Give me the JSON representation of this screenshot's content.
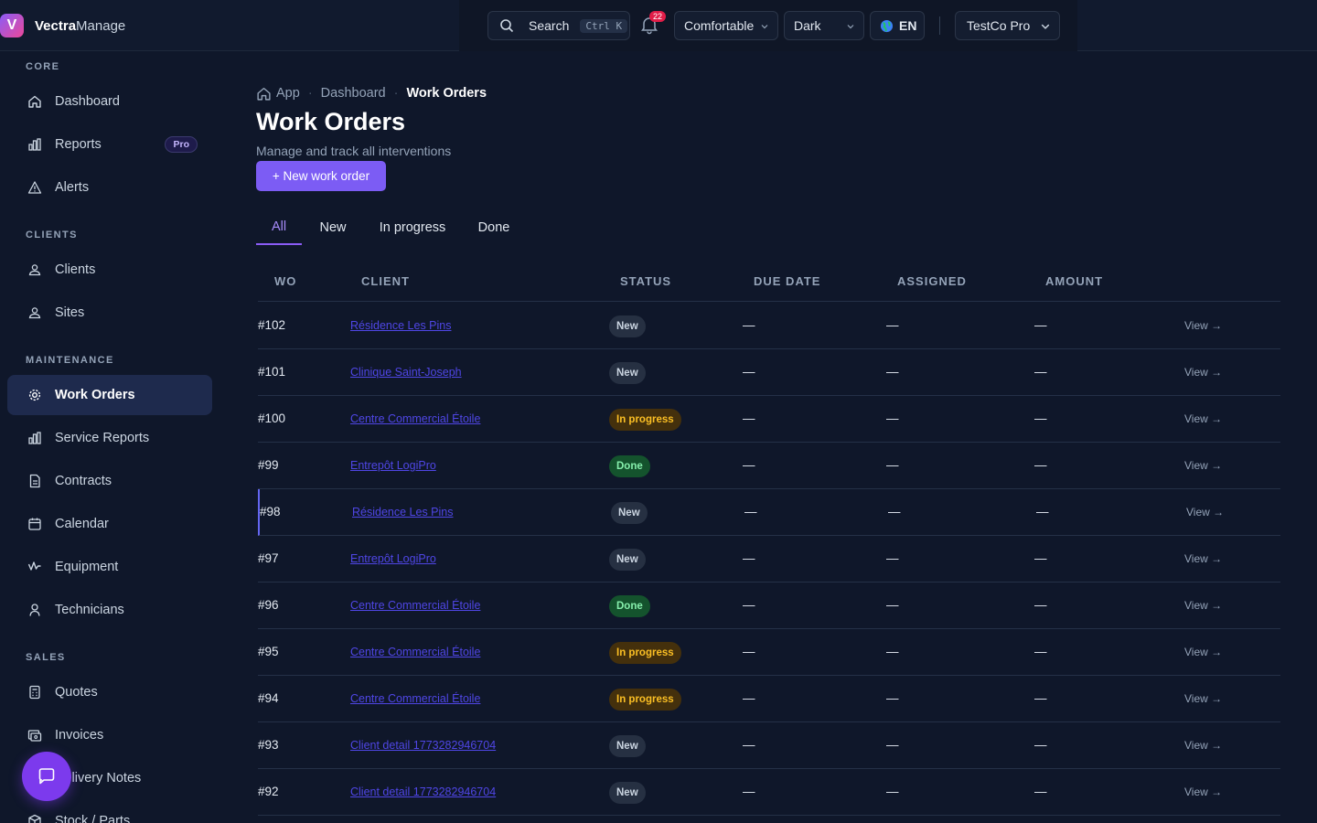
{
  "brand": {
    "name_bold": "Vectra",
    "name_light": "Manage",
    "logo_letter": "V"
  },
  "topbar": {
    "search_label": "Search",
    "search_shortcut": "Ctrl K",
    "notifications_count": "22",
    "density_label": "Comfortable",
    "theme_label": "Dark",
    "language_label": "EN",
    "org_label": "TestCo Pro"
  },
  "sidebar": {
    "sections": [
      {
        "title": "CORE",
        "items": [
          {
            "label": "Dashboard",
            "icon": "home-icon"
          },
          {
            "label": "Reports",
            "icon": "bar-chart-icon",
            "badge": "Pro"
          },
          {
            "label": "Alerts",
            "icon": "warning-icon"
          }
        ]
      },
      {
        "title": "CLIENTS",
        "items": [
          {
            "label": "Clients",
            "icon": "user-icon"
          },
          {
            "label": "Sites",
            "icon": "user-icon"
          }
        ]
      },
      {
        "title": "MAINTENANCE",
        "items": [
          {
            "label": "Work Orders",
            "icon": "gear-icon",
            "active": true
          },
          {
            "label": "Service Reports",
            "icon": "bar-chart-icon"
          },
          {
            "label": "Contracts",
            "icon": "document-icon"
          },
          {
            "label": "Calendar",
            "icon": "calendar-icon"
          },
          {
            "label": "Equipment",
            "icon": "activity-icon"
          },
          {
            "label": "Technicians",
            "icon": "person-icon"
          }
        ]
      },
      {
        "title": "SALES",
        "items": [
          {
            "label": "Quotes",
            "icon": "calculator-icon"
          },
          {
            "label": "Invoices",
            "icon": "invoice-icon"
          },
          {
            "label": "Delivery Notes",
            "icon": "truck-icon"
          },
          {
            "label": "Stock / Parts",
            "icon": "box-icon"
          }
        ]
      }
    ],
    "chat_icon": "chat-icon"
  },
  "main": {
    "breadcrumb": [
      "App",
      "Dashboard",
      "Work Orders"
    ],
    "title": "Work Orders",
    "subtitle": "Manage and track all interventions",
    "new_button": "+ New work order",
    "tabs": [
      "All",
      "New",
      "In progress",
      "Done"
    ],
    "active_tab": "All",
    "columns": [
      "WO",
      "CLIENT",
      "STATUS",
      "DUE DATE",
      "ASSIGNED",
      "AMOUNT"
    ],
    "rows": [
      {
        "wo": "#102",
        "client": "Résidence Les Pins",
        "status": "New",
        "due": "—",
        "assigned": "—",
        "amount": "—",
        "action": "View →"
      },
      {
        "wo": "#101",
        "client": "Clinique Saint-Joseph",
        "status": "New",
        "due": "—",
        "assigned": "—",
        "amount": "—",
        "action": "View →"
      },
      {
        "wo": "#100",
        "client": "Centre Commercial Étoile",
        "status": "In progress",
        "due": "—",
        "assigned": "—",
        "amount": "—",
        "action": "View →"
      },
      {
        "wo": "#99",
        "client": "Entrepôt LogiPro",
        "status": "Done",
        "due": "—",
        "assigned": "—",
        "amount": "—",
        "action": "View →"
      },
      {
        "wo": "#98",
        "client": "Résidence Les Pins",
        "status": "New",
        "due": "—",
        "assigned": "—",
        "amount": "—",
        "action": "View →"
      },
      {
        "wo": "#97",
        "client": "Entrepôt LogiPro",
        "status": "New",
        "due": "—",
        "assigned": "—",
        "amount": "—",
        "action": "View →"
      },
      {
        "wo": "#96",
        "client": "Centre Commercial Étoile",
        "status": "Done",
        "due": "—",
        "assigned": "—",
        "amount": "—",
        "action": "View →"
      },
      {
        "wo": "#95",
        "client": "Centre Commercial Étoile",
        "status": "In progress",
        "due": "—",
        "assigned": "—",
        "amount": "—",
        "action": "View →"
      },
      {
        "wo": "#94",
        "client": "Centre Commercial Étoile",
        "status": "In progress",
        "due": "—",
        "assigned": "—",
        "amount": "—",
        "action": "View →"
      },
      {
        "wo": "#93",
        "client": "Client detail 1773282946704",
        "status": "New",
        "due": "—",
        "assigned": "—",
        "amount": "—",
        "action": "View →"
      },
      {
        "wo": "#92",
        "client": "Client detail 1773282946704",
        "status": "New",
        "due": "—",
        "assigned": "—",
        "amount": "—",
        "action": "View →"
      }
    ]
  },
  "colors": {
    "accent": "#7c5cf4",
    "background": "#0f172a",
    "status_new": "#263042",
    "status_in_progress": "#44300c",
    "status_done": "#14532d",
    "link": "#4f46e5"
  }
}
